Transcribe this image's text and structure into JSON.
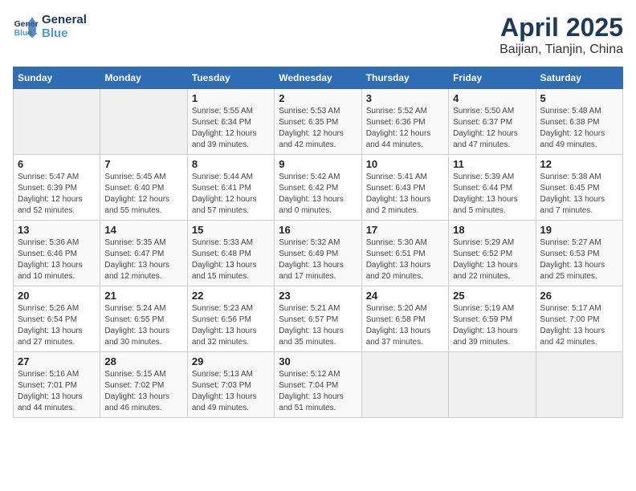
{
  "header": {
    "logo_line1": "General",
    "logo_line2": "Blue",
    "title": "April 2025",
    "subtitle": "Baijian, Tianjin, China"
  },
  "calendar": {
    "days_of_week": [
      "Sunday",
      "Monday",
      "Tuesday",
      "Wednesday",
      "Thursday",
      "Friday",
      "Saturday"
    ],
    "weeks": [
      [
        {
          "day": "",
          "sunrise": "",
          "sunset": "",
          "daylight": ""
        },
        {
          "day": "",
          "sunrise": "",
          "sunset": "",
          "daylight": ""
        },
        {
          "day": "1",
          "sunrise": "Sunrise: 5:55 AM",
          "sunset": "Sunset: 6:34 PM",
          "daylight": "Daylight: 12 hours and 39 minutes."
        },
        {
          "day": "2",
          "sunrise": "Sunrise: 5:53 AM",
          "sunset": "Sunset: 6:35 PM",
          "daylight": "Daylight: 12 hours and 42 minutes."
        },
        {
          "day": "3",
          "sunrise": "Sunrise: 5:52 AM",
          "sunset": "Sunset: 6:36 PM",
          "daylight": "Daylight: 12 hours and 44 minutes."
        },
        {
          "day": "4",
          "sunrise": "Sunrise: 5:50 AM",
          "sunset": "Sunset: 6:37 PM",
          "daylight": "Daylight: 12 hours and 47 minutes."
        },
        {
          "day": "5",
          "sunrise": "Sunrise: 5:48 AM",
          "sunset": "Sunset: 6:38 PM",
          "daylight": "Daylight: 12 hours and 49 minutes."
        }
      ],
      [
        {
          "day": "6",
          "sunrise": "Sunrise: 5:47 AM",
          "sunset": "Sunset: 6:39 PM",
          "daylight": "Daylight: 12 hours and 52 minutes."
        },
        {
          "day": "7",
          "sunrise": "Sunrise: 5:45 AM",
          "sunset": "Sunset: 6:40 PM",
          "daylight": "Daylight: 12 hours and 55 minutes."
        },
        {
          "day": "8",
          "sunrise": "Sunrise: 5:44 AM",
          "sunset": "Sunset: 6:41 PM",
          "daylight": "Daylight: 12 hours and 57 minutes."
        },
        {
          "day": "9",
          "sunrise": "Sunrise: 5:42 AM",
          "sunset": "Sunset: 6:42 PM",
          "daylight": "Daylight: 13 hours and 0 minutes."
        },
        {
          "day": "10",
          "sunrise": "Sunrise: 5:41 AM",
          "sunset": "Sunset: 6:43 PM",
          "daylight": "Daylight: 13 hours and 2 minutes."
        },
        {
          "day": "11",
          "sunrise": "Sunrise: 5:39 AM",
          "sunset": "Sunset: 6:44 PM",
          "daylight": "Daylight: 13 hours and 5 minutes."
        },
        {
          "day": "12",
          "sunrise": "Sunrise: 5:38 AM",
          "sunset": "Sunset: 6:45 PM",
          "daylight": "Daylight: 13 hours and 7 minutes."
        }
      ],
      [
        {
          "day": "13",
          "sunrise": "Sunrise: 5:36 AM",
          "sunset": "Sunset: 6:46 PM",
          "daylight": "Daylight: 13 hours and 10 minutes."
        },
        {
          "day": "14",
          "sunrise": "Sunrise: 5:35 AM",
          "sunset": "Sunset: 6:47 PM",
          "daylight": "Daylight: 13 hours and 12 minutes."
        },
        {
          "day": "15",
          "sunrise": "Sunrise: 5:33 AM",
          "sunset": "Sunset: 6:48 PM",
          "daylight": "Daylight: 13 hours and 15 minutes."
        },
        {
          "day": "16",
          "sunrise": "Sunrise: 5:32 AM",
          "sunset": "Sunset: 6:49 PM",
          "daylight": "Daylight: 13 hours and 17 minutes."
        },
        {
          "day": "17",
          "sunrise": "Sunrise: 5:30 AM",
          "sunset": "Sunset: 6:51 PM",
          "daylight": "Daylight: 13 hours and 20 minutes."
        },
        {
          "day": "18",
          "sunrise": "Sunrise: 5:29 AM",
          "sunset": "Sunset: 6:52 PM",
          "daylight": "Daylight: 13 hours and 22 minutes."
        },
        {
          "day": "19",
          "sunrise": "Sunrise: 5:27 AM",
          "sunset": "Sunset: 6:53 PM",
          "daylight": "Daylight: 13 hours and 25 minutes."
        }
      ],
      [
        {
          "day": "20",
          "sunrise": "Sunrise: 5:26 AM",
          "sunset": "Sunset: 6:54 PM",
          "daylight": "Daylight: 13 hours and 27 minutes."
        },
        {
          "day": "21",
          "sunrise": "Sunrise: 5:24 AM",
          "sunset": "Sunset: 6:55 PM",
          "daylight": "Daylight: 13 hours and 30 minutes."
        },
        {
          "day": "22",
          "sunrise": "Sunrise: 5:23 AM",
          "sunset": "Sunset: 6:56 PM",
          "daylight": "Daylight: 13 hours and 32 minutes."
        },
        {
          "day": "23",
          "sunrise": "Sunrise: 5:21 AM",
          "sunset": "Sunset: 6:57 PM",
          "daylight": "Daylight: 13 hours and 35 minutes."
        },
        {
          "day": "24",
          "sunrise": "Sunrise: 5:20 AM",
          "sunset": "Sunset: 6:58 PM",
          "daylight": "Daylight: 13 hours and 37 minutes."
        },
        {
          "day": "25",
          "sunrise": "Sunrise: 5:19 AM",
          "sunset": "Sunset: 6:59 PM",
          "daylight": "Daylight: 13 hours and 39 minutes."
        },
        {
          "day": "26",
          "sunrise": "Sunrise: 5:17 AM",
          "sunset": "Sunset: 7:00 PM",
          "daylight": "Daylight: 13 hours and 42 minutes."
        }
      ],
      [
        {
          "day": "27",
          "sunrise": "Sunrise: 5:16 AM",
          "sunset": "Sunset: 7:01 PM",
          "daylight": "Daylight: 13 hours and 44 minutes."
        },
        {
          "day": "28",
          "sunrise": "Sunrise: 5:15 AM",
          "sunset": "Sunset: 7:02 PM",
          "daylight": "Daylight: 13 hours and 46 minutes."
        },
        {
          "day": "29",
          "sunrise": "Sunrise: 5:13 AM",
          "sunset": "Sunset: 7:03 PM",
          "daylight": "Daylight: 13 hours and 49 minutes."
        },
        {
          "day": "30",
          "sunrise": "Sunrise: 5:12 AM",
          "sunset": "Sunset: 7:04 PM",
          "daylight": "Daylight: 13 hours and 51 minutes."
        },
        {
          "day": "",
          "sunrise": "",
          "sunset": "",
          "daylight": ""
        },
        {
          "day": "",
          "sunrise": "",
          "sunset": "",
          "daylight": ""
        },
        {
          "day": "",
          "sunrise": "",
          "sunset": "",
          "daylight": ""
        }
      ]
    ]
  }
}
